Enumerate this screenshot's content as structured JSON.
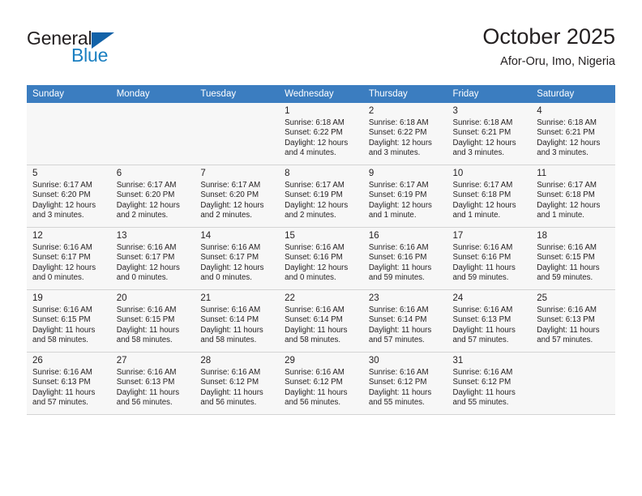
{
  "brand": {
    "name_part1": "General",
    "name_part2": "Blue",
    "logo_icon": "triangle-flag-icon",
    "accent_color": "#1a7fc1",
    "triangle_color": "#1262a8"
  },
  "header": {
    "title": "October 2025",
    "subtitle": "Afor-Oru, Imo, Nigeria"
  },
  "calendar": {
    "header_bg": "#3b7dc0",
    "header_text_color": "#ffffff",
    "weekdays": [
      "Sunday",
      "Monday",
      "Tuesday",
      "Wednesday",
      "Thursday",
      "Friday",
      "Saturday"
    ],
    "weeks": [
      [
        {
          "day": "",
          "detail": "",
          "empty": true
        },
        {
          "day": "",
          "detail": "",
          "empty": true
        },
        {
          "day": "",
          "detail": "",
          "empty": true
        },
        {
          "day": "1",
          "detail": "Sunrise: 6:18 AM\nSunset: 6:22 PM\nDaylight: 12 hours\nand 4 minutes."
        },
        {
          "day": "2",
          "detail": "Sunrise: 6:18 AM\nSunset: 6:22 PM\nDaylight: 12 hours\nand 3 minutes."
        },
        {
          "day": "3",
          "detail": "Sunrise: 6:18 AM\nSunset: 6:21 PM\nDaylight: 12 hours\nand 3 minutes."
        },
        {
          "day": "4",
          "detail": "Sunrise: 6:18 AM\nSunset: 6:21 PM\nDaylight: 12 hours\nand 3 minutes."
        }
      ],
      [
        {
          "day": "5",
          "detail": "Sunrise: 6:17 AM\nSunset: 6:20 PM\nDaylight: 12 hours\nand 3 minutes."
        },
        {
          "day": "6",
          "detail": "Sunrise: 6:17 AM\nSunset: 6:20 PM\nDaylight: 12 hours\nand 2 minutes."
        },
        {
          "day": "7",
          "detail": "Sunrise: 6:17 AM\nSunset: 6:20 PM\nDaylight: 12 hours\nand 2 minutes."
        },
        {
          "day": "8",
          "detail": "Sunrise: 6:17 AM\nSunset: 6:19 PM\nDaylight: 12 hours\nand 2 minutes."
        },
        {
          "day": "9",
          "detail": "Sunrise: 6:17 AM\nSunset: 6:19 PM\nDaylight: 12 hours\nand 1 minute."
        },
        {
          "day": "10",
          "detail": "Sunrise: 6:17 AM\nSunset: 6:18 PM\nDaylight: 12 hours\nand 1 minute."
        },
        {
          "day": "11",
          "detail": "Sunrise: 6:17 AM\nSunset: 6:18 PM\nDaylight: 12 hours\nand 1 minute."
        }
      ],
      [
        {
          "day": "12",
          "detail": "Sunrise: 6:16 AM\nSunset: 6:17 PM\nDaylight: 12 hours\nand 0 minutes."
        },
        {
          "day": "13",
          "detail": "Sunrise: 6:16 AM\nSunset: 6:17 PM\nDaylight: 12 hours\nand 0 minutes."
        },
        {
          "day": "14",
          "detail": "Sunrise: 6:16 AM\nSunset: 6:17 PM\nDaylight: 12 hours\nand 0 minutes."
        },
        {
          "day": "15",
          "detail": "Sunrise: 6:16 AM\nSunset: 6:16 PM\nDaylight: 12 hours\nand 0 minutes."
        },
        {
          "day": "16",
          "detail": "Sunrise: 6:16 AM\nSunset: 6:16 PM\nDaylight: 11 hours\nand 59 minutes."
        },
        {
          "day": "17",
          "detail": "Sunrise: 6:16 AM\nSunset: 6:16 PM\nDaylight: 11 hours\nand 59 minutes."
        },
        {
          "day": "18",
          "detail": "Sunrise: 6:16 AM\nSunset: 6:15 PM\nDaylight: 11 hours\nand 59 minutes."
        }
      ],
      [
        {
          "day": "19",
          "detail": "Sunrise: 6:16 AM\nSunset: 6:15 PM\nDaylight: 11 hours\nand 58 minutes."
        },
        {
          "day": "20",
          "detail": "Sunrise: 6:16 AM\nSunset: 6:15 PM\nDaylight: 11 hours\nand 58 minutes."
        },
        {
          "day": "21",
          "detail": "Sunrise: 6:16 AM\nSunset: 6:14 PM\nDaylight: 11 hours\nand 58 minutes."
        },
        {
          "day": "22",
          "detail": "Sunrise: 6:16 AM\nSunset: 6:14 PM\nDaylight: 11 hours\nand 58 minutes."
        },
        {
          "day": "23",
          "detail": "Sunrise: 6:16 AM\nSunset: 6:14 PM\nDaylight: 11 hours\nand 57 minutes."
        },
        {
          "day": "24",
          "detail": "Sunrise: 6:16 AM\nSunset: 6:13 PM\nDaylight: 11 hours\nand 57 minutes."
        },
        {
          "day": "25",
          "detail": "Sunrise: 6:16 AM\nSunset: 6:13 PM\nDaylight: 11 hours\nand 57 minutes."
        }
      ],
      [
        {
          "day": "26",
          "detail": "Sunrise: 6:16 AM\nSunset: 6:13 PM\nDaylight: 11 hours\nand 57 minutes."
        },
        {
          "day": "27",
          "detail": "Sunrise: 6:16 AM\nSunset: 6:13 PM\nDaylight: 11 hours\nand 56 minutes."
        },
        {
          "day": "28",
          "detail": "Sunrise: 6:16 AM\nSunset: 6:12 PM\nDaylight: 11 hours\nand 56 minutes."
        },
        {
          "day": "29",
          "detail": "Sunrise: 6:16 AM\nSunset: 6:12 PM\nDaylight: 11 hours\nand 56 minutes."
        },
        {
          "day": "30",
          "detail": "Sunrise: 6:16 AM\nSunset: 6:12 PM\nDaylight: 11 hours\nand 55 minutes."
        },
        {
          "day": "31",
          "detail": "Sunrise: 6:16 AM\nSunset: 6:12 PM\nDaylight: 11 hours\nand 55 minutes."
        },
        {
          "day": "",
          "detail": "",
          "empty": true
        }
      ]
    ]
  }
}
